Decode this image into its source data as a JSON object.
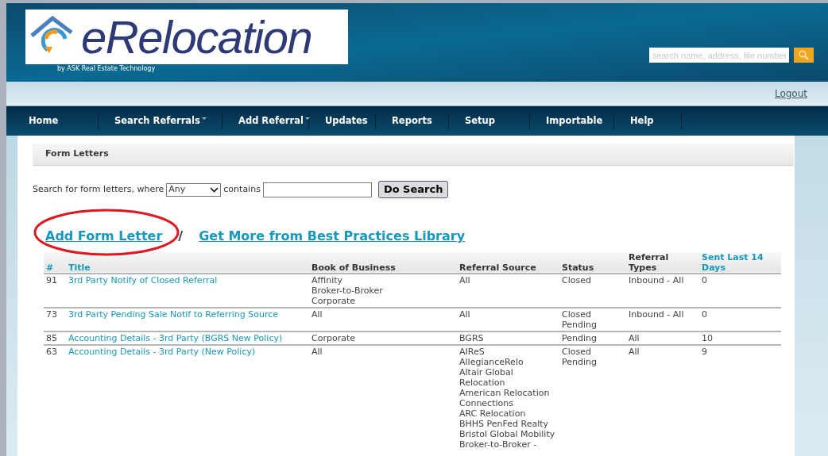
{
  "logo": {
    "wordmark": "eRelocation",
    "tagline": "by ASK Real Estate Technology"
  },
  "header_search": {
    "placeholder": "search name, address, file number"
  },
  "logout": "Logout",
  "nav": [
    {
      "label": "Home",
      "dropdown": false
    },
    {
      "label": "Search Referrals",
      "dropdown": true
    },
    {
      "label": "Add Referral",
      "dropdown": true
    },
    {
      "label": "Updates",
      "dropdown": false
    },
    {
      "label": "Reports",
      "dropdown": false
    },
    {
      "label": "Setup",
      "dropdown": false
    },
    {
      "label": "Importable",
      "dropdown": false
    },
    {
      "label": "Help",
      "dropdown": false
    }
  ],
  "panel_title": "Form Letters",
  "search_form": {
    "prefix": "Search for form letters, where",
    "field_value": "Any",
    "middle": "contains",
    "button": "Do Search"
  },
  "links": {
    "add": "Add Form Letter",
    "separator": "/",
    "library": "Get More from Best Practices Library"
  },
  "table": {
    "columns": [
      {
        "label": "#",
        "sortable": true
      },
      {
        "label": "Title",
        "sortable": true
      },
      {
        "label": "Book of Business",
        "sortable": false
      },
      {
        "label": "Referral Source",
        "sortable": false
      },
      {
        "label": "Status",
        "sortable": false
      },
      {
        "label": "Referral Types",
        "sortable": false
      },
      {
        "label": "Sent Last 14 Days",
        "sortable": true
      }
    ],
    "rows": [
      {
        "number": "91",
        "title": "3rd Party Notify of Closed Referral",
        "book_of_business": [
          "Affinity",
          "Broker-to-Broker",
          "Corporate"
        ],
        "referral_source": [
          "All"
        ],
        "status": [
          "Closed"
        ],
        "referral_types": [
          "Inbound - All"
        ],
        "sent": "0"
      },
      {
        "number": "73",
        "title": "3rd Party Pending Sale Notif to Referring Source",
        "book_of_business": [
          "All"
        ],
        "referral_source": [
          "All"
        ],
        "status": [
          "Closed",
          "Pending"
        ],
        "referral_types": [
          "Inbound - All"
        ],
        "sent": "0"
      },
      {
        "number": "85",
        "title": "Accounting Details - 3rd Party (BGRS New Policy)",
        "book_of_business": [
          "Corporate"
        ],
        "referral_source": [
          "BGRS"
        ],
        "status": [
          "Pending"
        ],
        "referral_types": [
          "All"
        ],
        "sent": "10"
      },
      {
        "number": "63",
        "title": "Accounting Details - 3rd Party (New Policy)",
        "book_of_business": [
          "All"
        ],
        "referral_source": [
          "AIReS",
          "AllegianceRelo",
          "Altair Global Relocation",
          "American Relocation Connections",
          "ARC Relocation",
          "BHHS PenFed Realty",
          "Bristol Global Mobility",
          "Broker-to-Broker -"
        ],
        "status": [
          "Closed",
          "Pending"
        ],
        "referral_types": [
          "All"
        ],
        "sent": "9"
      }
    ]
  }
}
